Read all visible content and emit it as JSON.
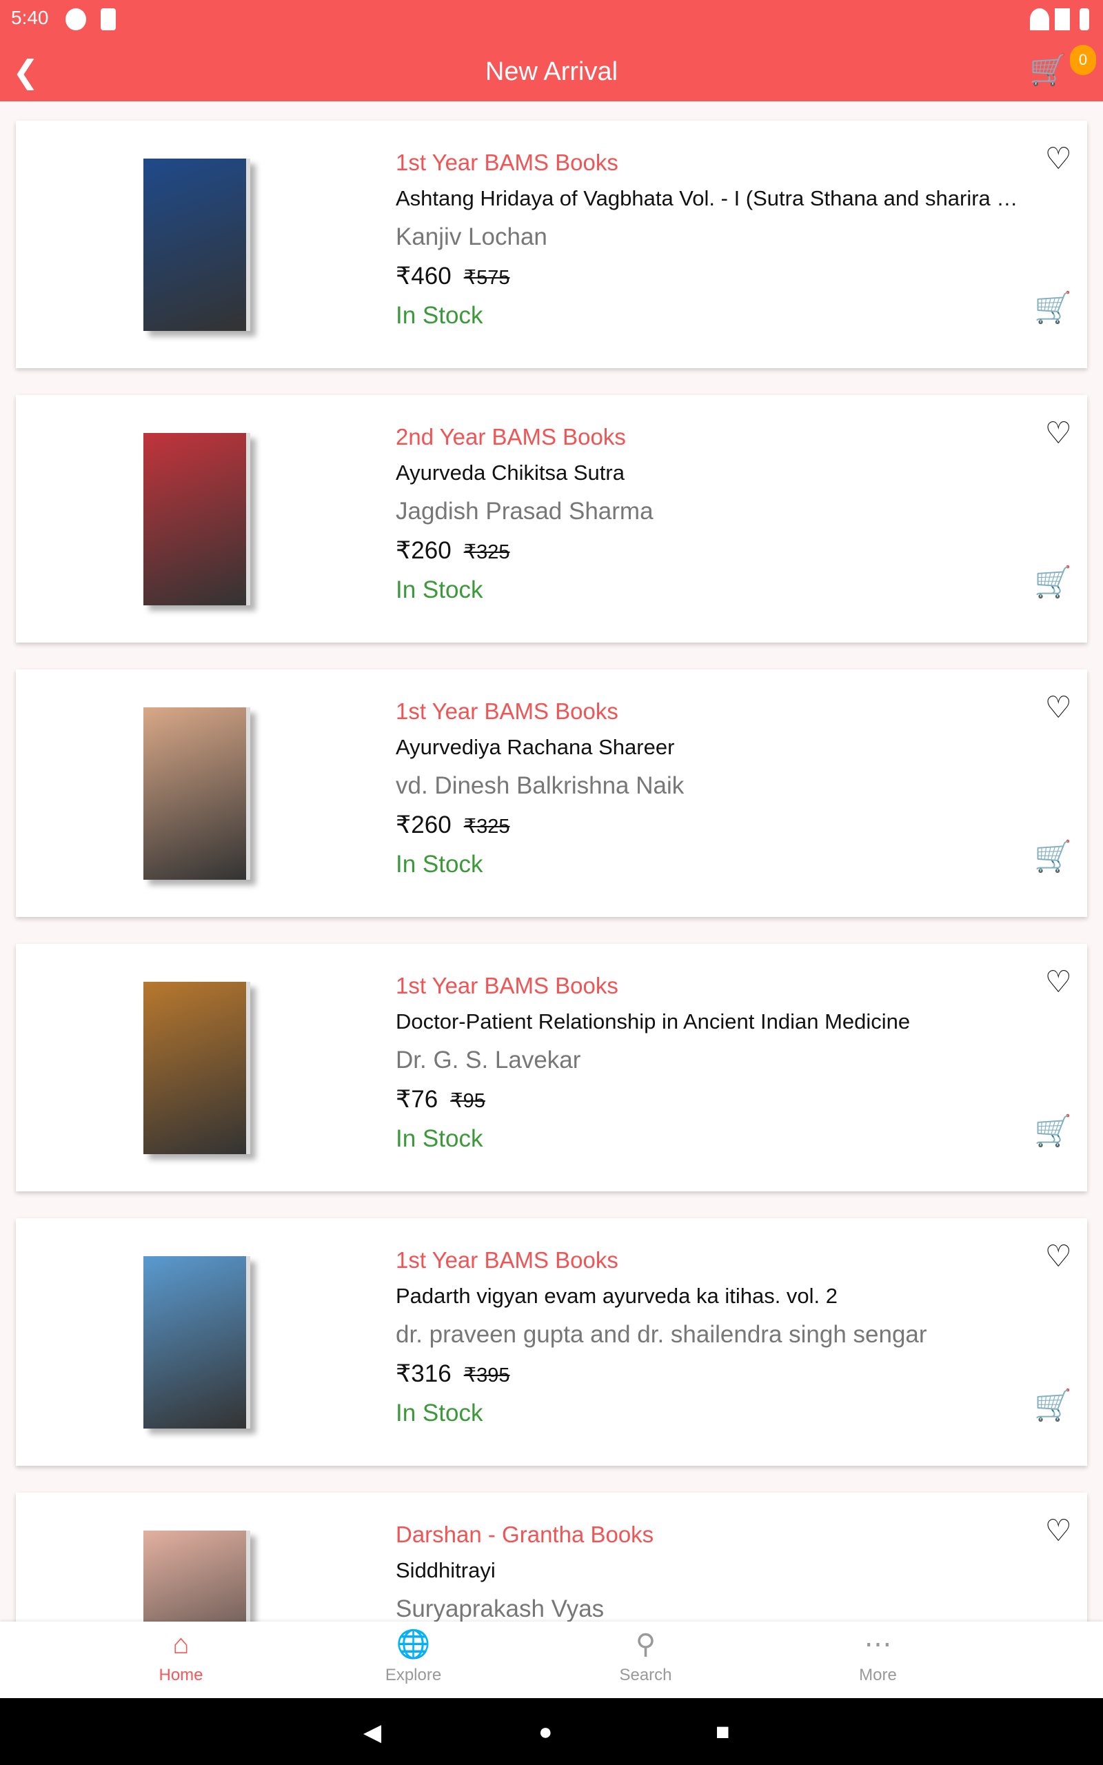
{
  "status": {
    "time": "5:40"
  },
  "appbar": {
    "title": "New Arrival",
    "cart_count": "0"
  },
  "colors": {
    "primary": "#f85757",
    "category": "#f05454",
    "in_stock": "#3a9a3a",
    "badge": "#ffa000"
  },
  "products": [
    {
      "category": "1st Year BAMS Books",
      "name": "Ashtang Hridaya of Vagbhata Vol. - I (Sutra Sthana and sharira sthana)",
      "author": "Kanjiv Lochan",
      "price": "₹460",
      "mrp": "₹575",
      "stock": "In Stock",
      "cover": "#1f4a8a"
    },
    {
      "category": "2nd Year BAMS Books",
      "name": "Ayurveda Chikitsa Sutra",
      "author": "Jagdish Prasad Sharma",
      "price": "₹260",
      "mrp": "₹325",
      "stock": "In Stock",
      "cover": "#c2343c"
    },
    {
      "category": "1st Year BAMS Books",
      "name": "Ayurvediya Rachana Shareer",
      "author": "vd. Dinesh Balkrishna Naik",
      "price": "₹260",
      "mrp": "₹325",
      "stock": "In Stock",
      "cover": "#d9a888"
    },
    {
      "category": "1st Year BAMS Books",
      "name": "Doctor-Patient Relationship in Ancient Indian Medicine",
      "author": "Dr. G. S. Lavekar",
      "price": "₹76",
      "mrp": "₹95",
      "stock": "In Stock",
      "cover": "#b8782e"
    },
    {
      "category": "1st Year BAMS Books",
      "name": "Padarth vigyan evam ayurveda ka itihas. vol. 2",
      "author": "dr. praveen gupta and dr. shailendra singh sengar",
      "price": "₹316",
      "mrp": "₹395",
      "stock": "In Stock",
      "cover": "#5a9ad0"
    },
    {
      "category": "Darshan - Grantha Books",
      "name": "Siddhitrayi",
      "author": "Suryaprakash Vyas",
      "cover": "#e2b0a0"
    }
  ],
  "bottom_nav": [
    {
      "label": "Home",
      "icon": "home-icon"
    },
    {
      "label": "Explore",
      "icon": "explore-icon"
    },
    {
      "label": "Search",
      "icon": "search-icon"
    },
    {
      "label": "More",
      "icon": "more-icon"
    }
  ]
}
